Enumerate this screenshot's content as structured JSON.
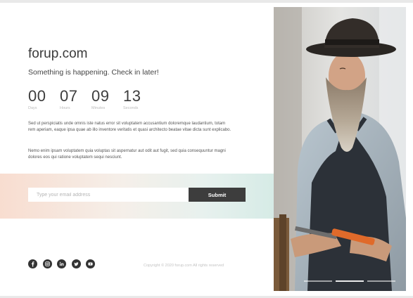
{
  "site": {
    "title": "forup.com",
    "tagline": "Something is happening. Check in later!"
  },
  "countdown": [
    {
      "value": "00",
      "label": "Days"
    },
    {
      "value": "07",
      "label": "Hours"
    },
    {
      "value": "09",
      "label": "Minutes"
    },
    {
      "value": "13",
      "label": "Seconds"
    }
  ],
  "paragraphs": [
    "Sed ut perspiciatis unde omnis iste natus error sit voluptatem accusantium doloremque laudantium, totam rem aperiam, eaque ipsa quae ab illo inventore veritatis et quasi architecto beatae vitae dicta sunt explicabo.",
    "Nemo enim ipsam voluptatem quia voluptas sit aspernatur aut odit aut fugit, sed quia consequuntur magni dolores eos qui ratione voluptatem sequi nesciunt."
  ],
  "subscribe": {
    "placeholder": "Type your email address",
    "value": "",
    "button_label": "Submit"
  },
  "social": [
    {
      "icon": "facebook-icon"
    },
    {
      "icon": "instagram-icon"
    },
    {
      "icon": "linkedin-icon"
    },
    {
      "icon": "twitter-icon"
    },
    {
      "icon": "youtube-icon"
    }
  ],
  "footer": {
    "copyright": "Copyright © 2020 forup.com All rights reserved"
  },
  "slider": {
    "slides": 3,
    "active": 1
  },
  "colors": {
    "button_bg": "#3d3d3d",
    "gradient_left": "#f8ddd0",
    "gradient_right": "#d6ebe6"
  }
}
